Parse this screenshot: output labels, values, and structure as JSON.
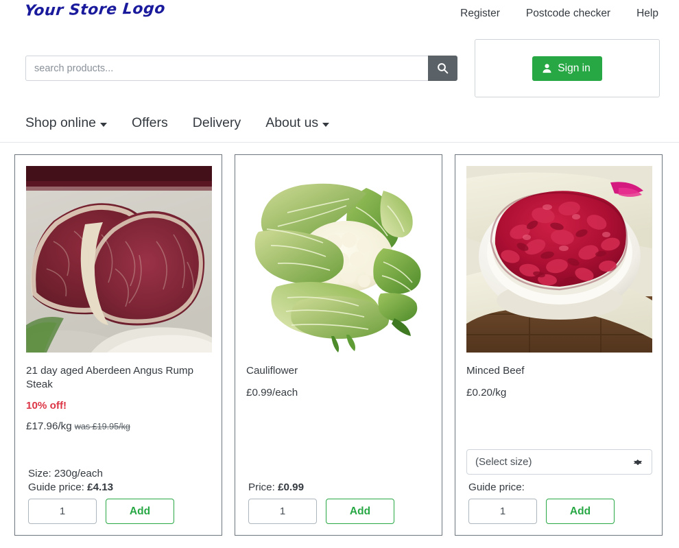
{
  "brand": {
    "logo_text": "Your Store Logo",
    "logo_color": "#1a1a9c"
  },
  "header": {
    "top_links": [
      {
        "label": "Register"
      },
      {
        "label": "Postcode checker"
      },
      {
        "label": "Help"
      }
    ],
    "search": {
      "placeholder": "search products...",
      "value": "",
      "icon": "search-icon"
    },
    "signin": {
      "label": "Sign in",
      "icon": "user-icon",
      "color": "#28a745"
    }
  },
  "nav": {
    "items": [
      {
        "label": "Shop online",
        "has_caret": true
      },
      {
        "label": "Offers",
        "has_caret": false
      },
      {
        "label": "Delivery",
        "has_caret": false
      },
      {
        "label": "About us",
        "has_caret": true
      }
    ]
  },
  "products": [
    {
      "name": "21 day aged Aberdeen Angus Rump Steak",
      "promo": "10% off!",
      "promo_color": "#dc3545",
      "unit_price": "£17.96/kg",
      "was_price": "was £19.95/kg",
      "size_label": "Size: 230g/each",
      "price_label": "Guide price:",
      "price_value": "£4.13",
      "qty": "1",
      "add_label": "Add",
      "image_alt": "raw-rump-steak-photo",
      "has_select": false
    },
    {
      "name": "Cauliflower",
      "promo": "",
      "promo_color": "#dc3545",
      "unit_price": "£0.99/each",
      "was_price": "",
      "size_label": "",
      "price_label": "Price:",
      "price_value": "£0.99",
      "qty": "1",
      "add_label": "Add",
      "image_alt": "cauliflower-photo",
      "has_select": false
    },
    {
      "name": "Minced Beef",
      "promo": "",
      "promo_color": "#dc3545",
      "unit_price": "£0.20/kg",
      "was_price": "",
      "size_label": "",
      "price_label": "Guide price:",
      "price_value": "",
      "qty": "1",
      "add_label": "Add",
      "image_alt": "minced-beef-bowl-photo",
      "has_select": true,
      "select_value": "(Select size)"
    }
  ]
}
